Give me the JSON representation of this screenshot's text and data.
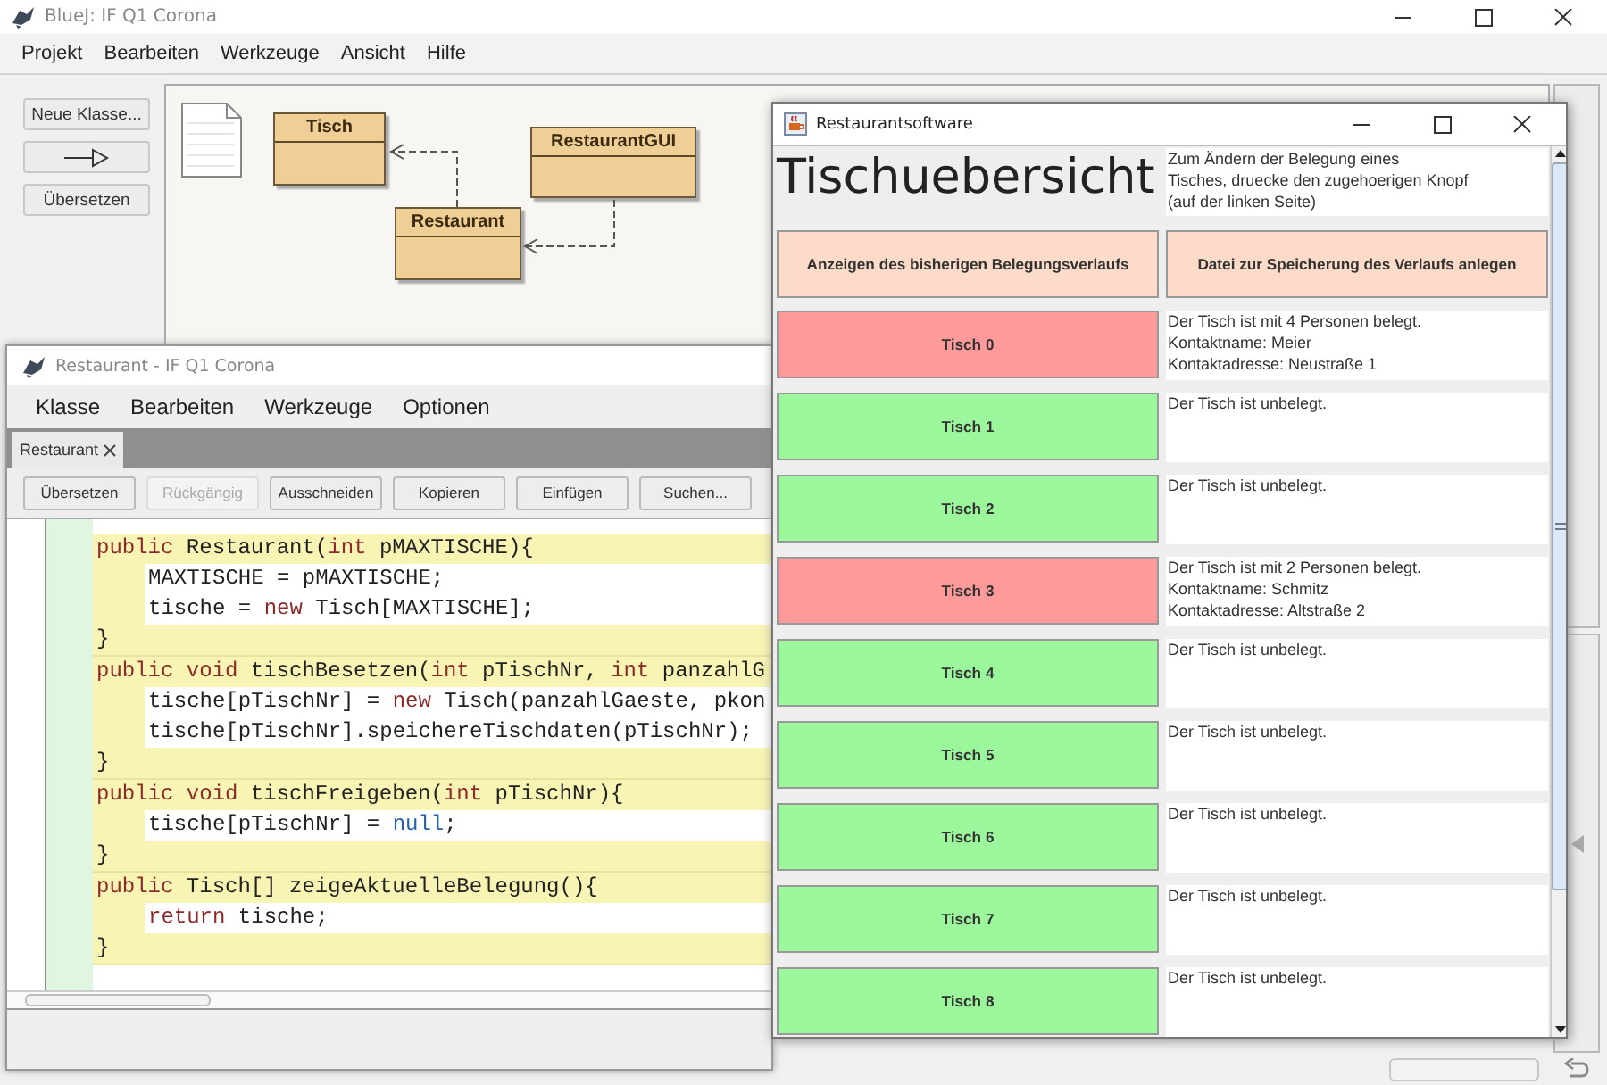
{
  "main_window": {
    "title": "BlueJ:  IF Q1 Corona",
    "menu": [
      "Projekt",
      "Bearbeiten",
      "Werkzeuge",
      "Ansicht",
      "Hilfe"
    ],
    "tools": [
      {
        "kind": "text",
        "label": "Neue Klasse..."
      },
      {
        "kind": "arrow"
      },
      {
        "kind": "text",
        "label": "Übersetzen"
      }
    ],
    "classes": [
      {
        "name": "Tisch"
      },
      {
        "name": "Restaurant"
      },
      {
        "name": "RestaurantGUI"
      }
    ]
  },
  "editor": {
    "title": "Restaurant - IF Q1 Corona",
    "menu": [
      "Klasse",
      "Bearbeiten",
      "Werkzeuge",
      "Optionen"
    ],
    "tabs": [
      {
        "label": "Restaurant",
        "selected": true
      }
    ],
    "toolbar": [
      {
        "label": "Übersetzen",
        "disabled": false
      },
      {
        "label": "Rückgängig",
        "disabled": true
      },
      {
        "label": "Ausschneiden",
        "disabled": false
      },
      {
        "label": "Kopieren",
        "disabled": false
      },
      {
        "label": "Einfügen",
        "disabled": false
      },
      {
        "label": "Suchen...",
        "disabled": false
      }
    ],
    "methods": [
      {
        "header": [
          {
            "kind": "keyword",
            "text": "public"
          },
          {
            "kind": "plain",
            "text": " Restaurant("
          },
          {
            "kind": "keyword",
            "text": "int"
          },
          {
            "kind": "plain",
            "text": " pMAXTISCHE){"
          }
        ],
        "body": [
          [
            {
              "kind": "plain",
              "text": "MAXTISCHE = pMAXTISCHE;"
            }
          ],
          [
            {
              "kind": "plain",
              "text": "tische = "
            },
            {
              "kind": "keyword",
              "text": "new"
            },
            {
              "kind": "plain",
              "text": " Tisch[MAXTISCHE];"
            }
          ]
        ],
        "close": "}"
      },
      {
        "header": [
          {
            "kind": "keyword",
            "text": "public void"
          },
          {
            "kind": "plain",
            "text": " tischBesetzen("
          },
          {
            "kind": "keyword",
            "text": "int"
          },
          {
            "kind": "plain",
            "text": " pTischNr, "
          },
          {
            "kind": "keyword",
            "text": "int"
          },
          {
            "kind": "plain",
            "text": " panzahlG"
          }
        ],
        "body": [
          [
            {
              "kind": "plain",
              "text": "tische[pTischNr] = "
            },
            {
              "kind": "keyword",
              "text": "new"
            },
            {
              "kind": "plain",
              "text": " Tisch(panzahlGaeste, pkon"
            }
          ],
          [
            {
              "kind": "plain",
              "text": "tische[pTischNr].speichereTischdaten(pTischNr);"
            }
          ]
        ],
        "close": "}"
      },
      {
        "header": [
          {
            "kind": "keyword",
            "text": "public void"
          },
          {
            "kind": "plain",
            "text": " tischFreigeben("
          },
          {
            "kind": "keyword",
            "text": "int"
          },
          {
            "kind": "plain",
            "text": " pTischNr){"
          }
        ],
        "body": [
          [
            {
              "kind": "plain",
              "text": "tische[pTischNr] = "
            },
            {
              "kind": "literal",
              "text": "null"
            },
            {
              "kind": "plain",
              "text": ";"
            }
          ]
        ],
        "close": "}"
      },
      {
        "header": [
          {
            "kind": "keyword",
            "text": "public"
          },
          {
            "kind": "plain",
            "text": " Tisch[] zeigeAktuelleBelegung(){"
          }
        ],
        "body": [
          [
            {
              "kind": "keyword",
              "text": "return"
            },
            {
              "kind": "plain",
              "text": " tische;"
            }
          ]
        ],
        "close": "}"
      }
    ]
  },
  "restaurant_app": {
    "title": "Restaurantsoftware",
    "heading": "Tischuebersicht",
    "hint": "Zum Ändern der Belegung eines\nTisches, druecke den zugehoerigen Knopf\n(auf der linken Seite)",
    "actions": [
      "Anzeigen des bisherigen Belegungsverlaufs",
      "Datei zur Speicherung des Verlaufs anlegen"
    ],
    "tables": [
      {
        "label": "Tisch 0",
        "occupied": true,
        "info": "Der Tisch ist mit 4 Personen belegt.\nKontaktname: Meier\nKontaktadresse: Neustraße 1"
      },
      {
        "label": "Tisch 1",
        "occupied": false,
        "info": "Der Tisch ist unbelegt."
      },
      {
        "label": "Tisch 2",
        "occupied": false,
        "info": "Der Tisch ist unbelegt."
      },
      {
        "label": "Tisch 3",
        "occupied": true,
        "info": "Der Tisch ist mit 2 Personen belegt.\nKontaktname: Schmitz\nKontaktadresse: Altstraße 2"
      },
      {
        "label": "Tisch 4",
        "occupied": false,
        "info": "Der Tisch ist unbelegt."
      },
      {
        "label": "Tisch 5",
        "occupied": false,
        "info": "Der Tisch ist unbelegt."
      },
      {
        "label": "Tisch 6",
        "occupied": false,
        "info": "Der Tisch ist unbelegt."
      },
      {
        "label": "Tisch 7",
        "occupied": false,
        "info": "Der Tisch ist unbelegt."
      },
      {
        "label": "Tisch 8",
        "occupied": false,
        "info": "Der Tisch ist unbelegt."
      }
    ]
  }
}
